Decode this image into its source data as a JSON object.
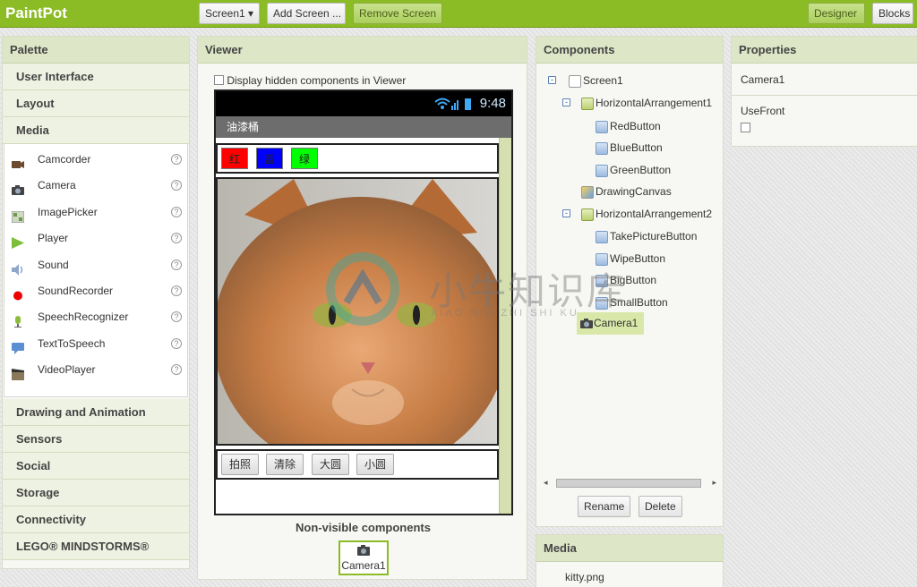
{
  "app": {
    "title": "PaintPot"
  },
  "toolbar": {
    "screen_select": "Screen1 ▾",
    "add_screen": "Add Screen ...",
    "remove_screen": "Remove Screen",
    "designer": "Designer",
    "blocks": "Blocks"
  },
  "palette": {
    "title": "Palette",
    "categories_top": [
      "User Interface",
      "Layout",
      "Media"
    ],
    "media_items": [
      {
        "label": "Camcorder",
        "icon": "camcorder-icon"
      },
      {
        "label": "Camera",
        "icon": "camera-icon"
      },
      {
        "label": "ImagePicker",
        "icon": "imagepicker-icon"
      },
      {
        "label": "Player",
        "icon": "player-icon"
      },
      {
        "label": "Sound",
        "icon": "sound-icon"
      },
      {
        "label": "SoundRecorder",
        "icon": "soundrecorder-icon"
      },
      {
        "label": "SpeechRecognizer",
        "icon": "speechrecognizer-icon"
      },
      {
        "label": "TextToSpeech",
        "icon": "texttospeech-icon"
      },
      {
        "label": "VideoPlayer",
        "icon": "videoplayer-icon"
      }
    ],
    "help_glyph": "?",
    "categories_bottom": [
      "Drawing and Animation",
      "Sensors",
      "Social",
      "Storage",
      "Connectivity",
      "LEGO® MINDSTORMS®"
    ]
  },
  "viewer": {
    "title": "Viewer",
    "hidden_checkbox_label": "Display hidden components in Viewer",
    "status_time": "9:48",
    "app_title": "油漆桶",
    "color_buttons": [
      {
        "label": "红",
        "color": "#ff0000"
      },
      {
        "label": "蓝",
        "color": "#0000ff"
      },
      {
        "label": "绿",
        "color": "#00ff00"
      }
    ],
    "action_buttons": [
      "拍照",
      "清除",
      "大圆",
      "小圆"
    ],
    "nonvisible_title": "Non-visible components",
    "nonvisible_item": "Camera1"
  },
  "watermark": {
    "text": "小牛知识库",
    "subtext": "XIAO NIU ZHI SHI KU"
  },
  "components": {
    "title": "Components",
    "tree": [
      {
        "label": "Screen1",
        "level": 0,
        "toggle": "-"
      },
      {
        "label": "HorizontalArrangement1",
        "level": 1,
        "toggle": "-"
      },
      {
        "label": "RedButton",
        "level": 2
      },
      {
        "label": "BlueButton",
        "level": 2
      },
      {
        "label": "GreenButton",
        "level": 2
      },
      {
        "label": "DrawingCanvas",
        "level": 1
      },
      {
        "label": "HorizontalArrangement2",
        "level": 1,
        "toggle": "-"
      },
      {
        "label": "TakePictureButton",
        "level": 2
      },
      {
        "label": "WipeButton",
        "level": 2
      },
      {
        "label": "BigButton",
        "level": 2
      },
      {
        "label": "SmallButton",
        "level": 2
      },
      {
        "label": "Camera1",
        "level": 1,
        "selected": true
      }
    ],
    "rename": "Rename",
    "delete": "Delete"
  },
  "media": {
    "title": "Media",
    "items": [
      "kitty.png"
    ]
  },
  "properties": {
    "title": "Properties",
    "component": "Camera1",
    "prop_label": "UseFront",
    "use_front_checked": false
  },
  "colors": {
    "accent": "#8cbc25",
    "panel_head": "#dde6c6",
    "selected": "#d9e8a8"
  }
}
